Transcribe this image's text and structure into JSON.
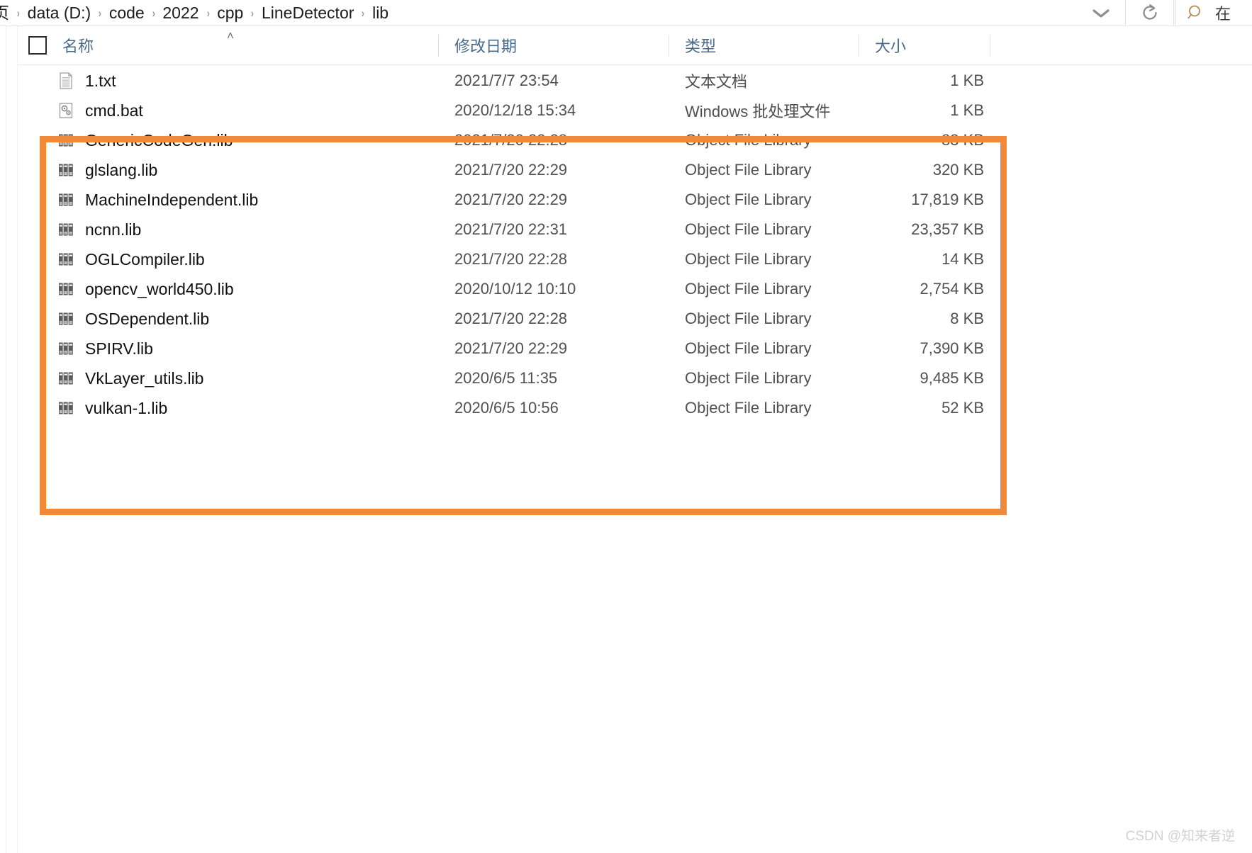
{
  "window": {
    "address_bar": {
      "breadcrumb_segments": [
        "页",
        "data (D:)",
        "code",
        "2022",
        "cpp",
        "LineDetector",
        "lib"
      ],
      "separator": "›",
      "dropdown_icon": "chevron-down-icon",
      "refresh_icon": "refresh-icon"
    },
    "search": {
      "icon": "search-icon",
      "placeholder": "在"
    }
  },
  "columns": [
    {
      "key": "name",
      "label": "名称",
      "sort": "ascending"
    },
    {
      "key": "date",
      "label": "修改日期",
      "sort": "none"
    },
    {
      "key": "type",
      "label": "类型",
      "sort": "none"
    },
    {
      "key": "size",
      "label": "大小",
      "sort": "none"
    }
  ],
  "select_all_checkbox": {
    "checked": false
  },
  "sort_caret": "˄",
  "files": [
    {
      "name": "1.txt",
      "date": "2021/7/7 23:54",
      "type": "文本文档",
      "size": "1 KB",
      "icon": "text-document-icon",
      "highlighted": false
    },
    {
      "name": "cmd.bat",
      "date": "2020/12/18 15:34",
      "type": "Windows 批处理文件",
      "size": "1 KB",
      "icon": "batch-file-icon",
      "highlighted": false
    },
    {
      "name": "GenericCodeGen.lib",
      "date": "2021/7/20 22:28",
      "type": "Object File Library",
      "size": "83 KB",
      "icon": "object-library-icon",
      "highlighted": true
    },
    {
      "name": "glslang.lib",
      "date": "2021/7/20 22:29",
      "type": "Object File Library",
      "size": "320 KB",
      "icon": "object-library-icon",
      "highlighted": true
    },
    {
      "name": "MachineIndependent.lib",
      "date": "2021/7/20 22:29",
      "type": "Object File Library",
      "size": "17,819 KB",
      "icon": "object-library-icon",
      "highlighted": true
    },
    {
      "name": "ncnn.lib",
      "date": "2021/7/20 22:31",
      "type": "Object File Library",
      "size": "23,357 KB",
      "icon": "object-library-icon",
      "highlighted": true
    },
    {
      "name": "OGLCompiler.lib",
      "date": "2021/7/20 22:28",
      "type": "Object File Library",
      "size": "14 KB",
      "icon": "object-library-icon",
      "highlighted": true
    },
    {
      "name": "opencv_world450.lib",
      "date": "2020/10/12 10:10",
      "type": "Object File Library",
      "size": "2,754 KB",
      "icon": "object-library-icon",
      "highlighted": true
    },
    {
      "name": "OSDependent.lib",
      "date": "2021/7/20 22:28",
      "type": "Object File Library",
      "size": "8 KB",
      "icon": "object-library-icon",
      "highlighted": true
    },
    {
      "name": "SPIRV.lib",
      "date": "2021/7/20 22:29",
      "type": "Object File Library",
      "size": "7,390 KB",
      "icon": "object-library-icon",
      "highlighted": true
    },
    {
      "name": "VkLayer_utils.lib",
      "date": "2020/6/5 11:35",
      "type": "Object File Library",
      "size": "9,485 KB",
      "icon": "object-library-icon",
      "highlighted": true
    },
    {
      "name": "vulkan-1.lib",
      "date": "2020/6/5 10:56",
      "type": "Object File Library",
      "size": "52 KB",
      "icon": "object-library-icon",
      "highlighted": true
    }
  ],
  "annotation": {
    "type": "rectangle-highlight",
    "color": "#F08A38"
  },
  "watermark": {
    "text": "CSDN @知来者逆"
  }
}
